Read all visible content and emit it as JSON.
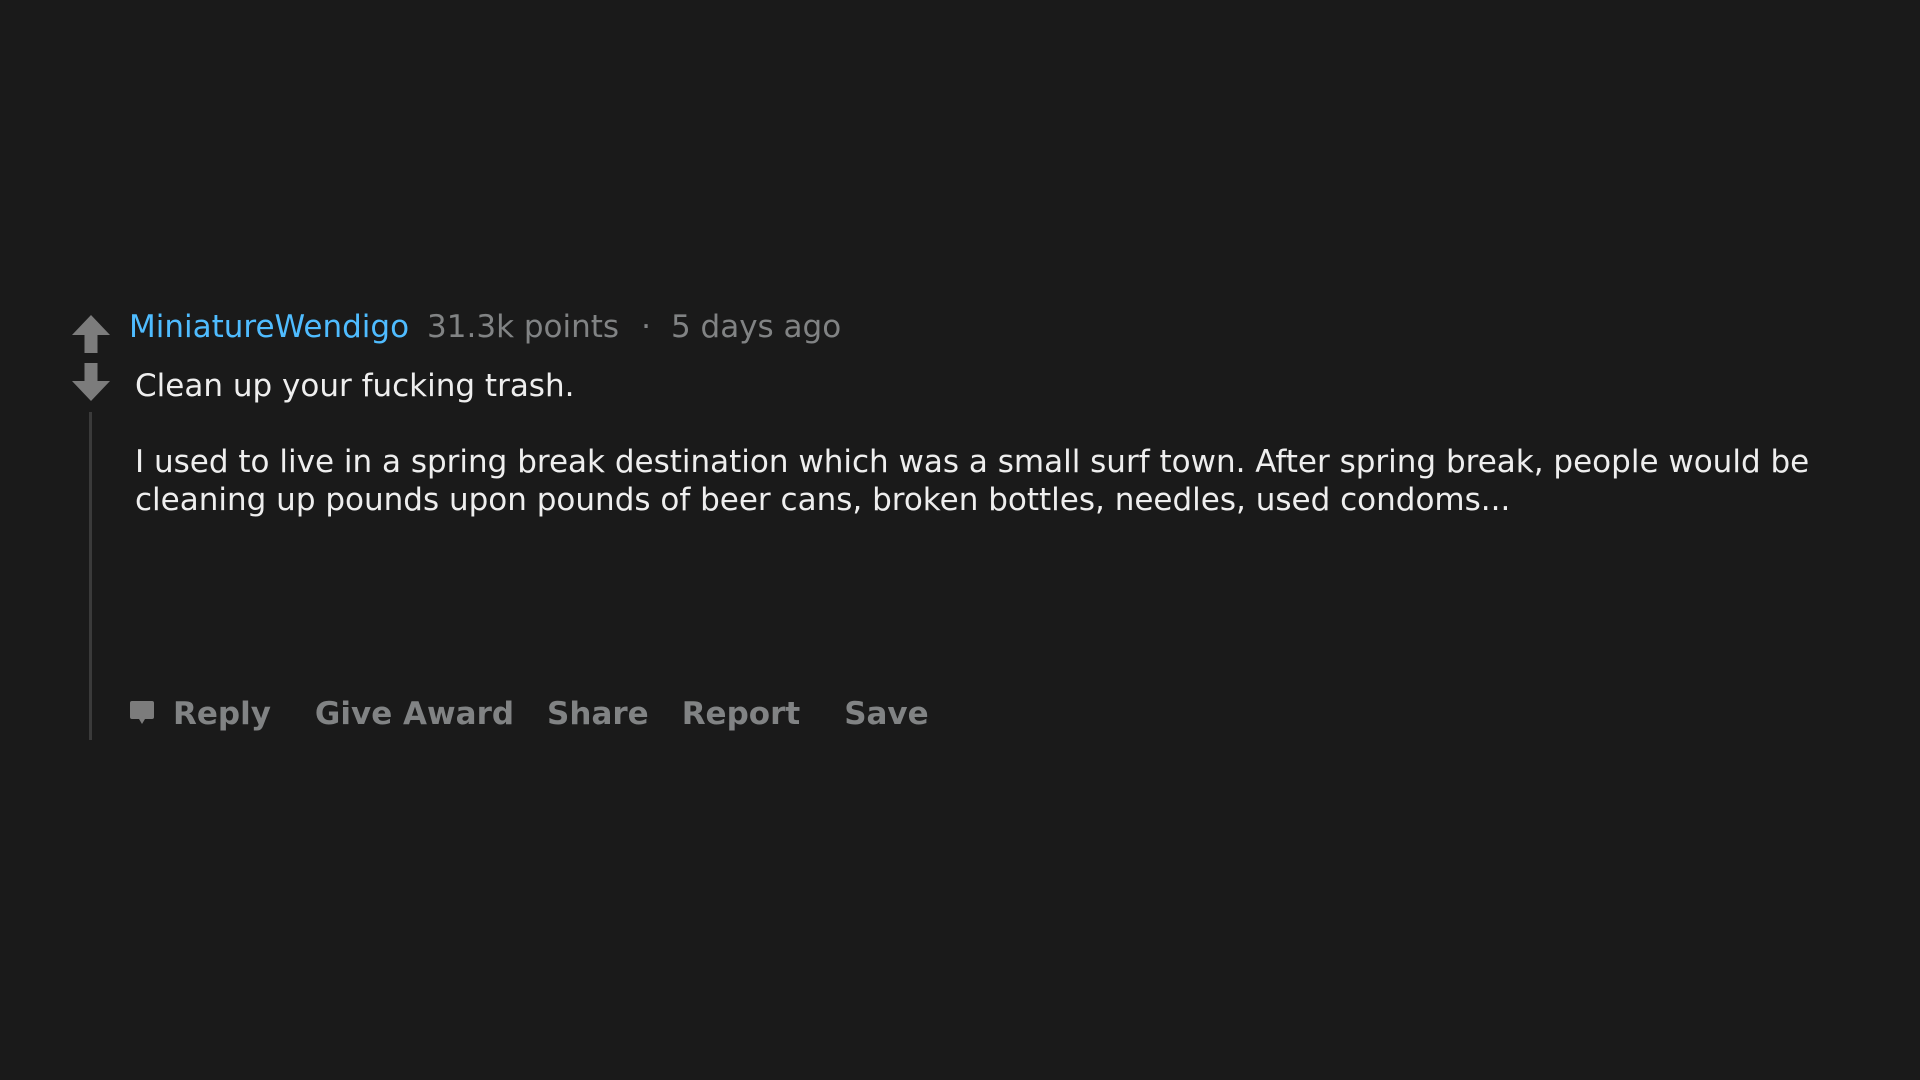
{
  "comment": {
    "author": "MiniatureWendigo",
    "points": "31.3k points",
    "separator": "·",
    "time": "5 days ago",
    "body": [
      "Clean up your fucking trash.",
      "I used to live in a spring break destination which was a small surf town. After spring break, people would be cleaning up pounds upon pounds of beer cans, broken bottles, needles, used condoms..."
    ]
  },
  "actions": {
    "reply": "Reply",
    "give_award": "Give Award",
    "share": "Share",
    "report": "Report",
    "save": "Save"
  },
  "icons": {
    "upvote": "upvote-arrow-icon",
    "downvote": "downvote-arrow-icon",
    "reply": "comment-bubble-icon"
  },
  "colors": {
    "background": "#1a1a1a",
    "author": "#4fbcff",
    "meta": "#818384",
    "body_text": "#eeeeee",
    "icon": "#7c7c7c",
    "thread_line": "#3a3a3a"
  }
}
